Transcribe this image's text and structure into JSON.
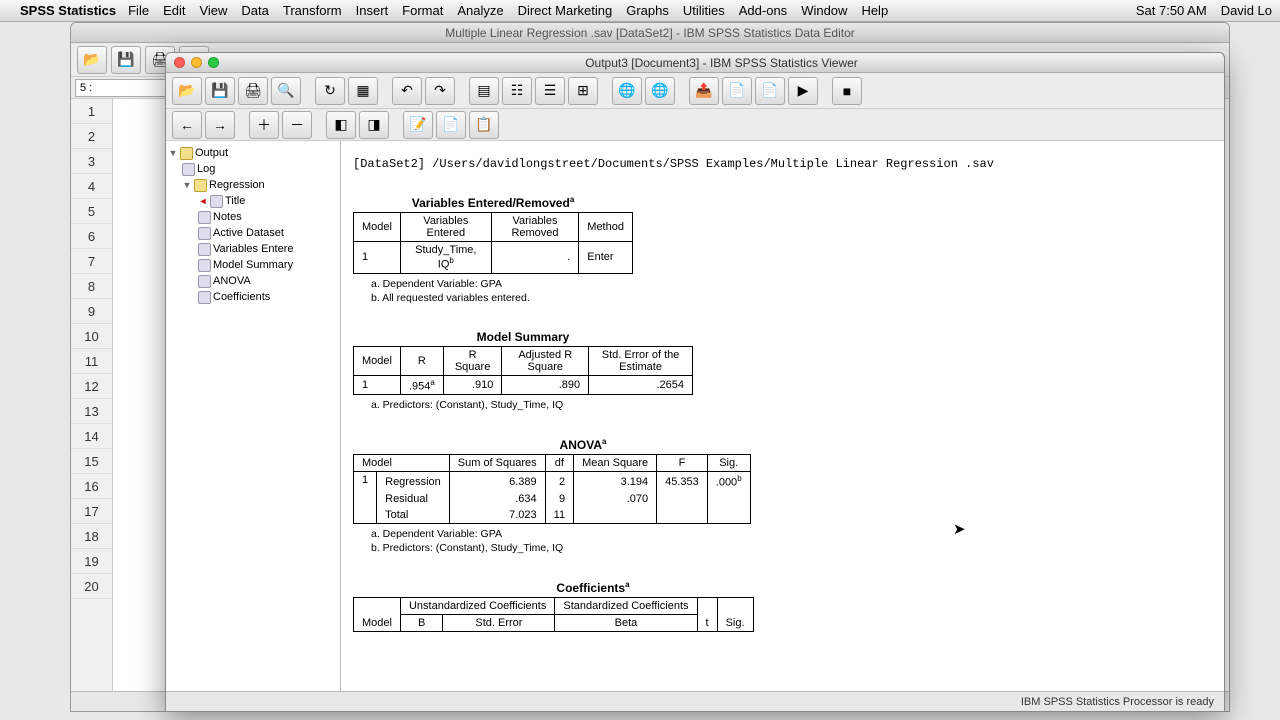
{
  "menubar": {
    "app": "SPSS Statistics",
    "items": [
      "File",
      "Edit",
      "View",
      "Data",
      "Transform",
      "Insert",
      "Format",
      "Analyze",
      "Direct Marketing",
      "Graphs",
      "Utilities",
      "Add-ons",
      "Window",
      "Help"
    ],
    "clock": "Sat 7:50 AM",
    "user": "David Lo"
  },
  "data_editor": {
    "title": "Multiple Linear Regression .sav [DataSet2] - IBM SPSS Statistics Data Editor",
    "cell_indicator": "5 :",
    "rows": [
      "1",
      "2",
      "3",
      "4",
      "5",
      "6",
      "7",
      "8",
      "9",
      "10",
      "11",
      "12",
      "13",
      "14",
      "15",
      "16",
      "17",
      "18",
      "19",
      "20"
    ],
    "status": "IBM SPSS Statistics Processor is ready"
  },
  "viewer": {
    "title": "Output3 [Document3] - IBM SPSS Statistics Viewer",
    "outline": {
      "root": "Output",
      "log": "Log",
      "regression": "Regression",
      "children": [
        "Title",
        "Notes",
        "Active Dataset",
        "Variables Entere",
        "Model Summary",
        "ANOVA",
        "Coefficients"
      ]
    },
    "dataset_line": "[DataSet2] /Users/davidlongstreet/Documents/SPSS Examples/Multiple Linear Regression .sav",
    "t1": {
      "title": "Variables Entered/Removed",
      "headers": {
        "model": "Model",
        "entered": "Variables Entered",
        "removed": "Variables Removed",
        "method": "Method"
      },
      "row": {
        "model": "1",
        "entered": "Study_Time, IQ",
        "removed": ".",
        "method": "Enter"
      },
      "fn_a": "a. Dependent Variable: GPA",
      "fn_b": "b. All requested variables entered."
    },
    "t2": {
      "title": "Model Summary",
      "headers": {
        "model": "Model",
        "r": "R",
        "r2": "R Square",
        "adjr2": "Adjusted R Square",
        "se": "Std. Error of the Estimate"
      },
      "row": {
        "model": "1",
        "r": ".954",
        "r2": ".910",
        "adjr2": ".890",
        "se": ".2654"
      },
      "fn_a": "a. Predictors: (Constant), Study_Time, IQ"
    },
    "t3": {
      "title": "ANOVA",
      "headers": {
        "model": "Model",
        "ss": "Sum of Squares",
        "df": "df",
        "ms": "Mean Square",
        "f": "F",
        "sig": "Sig."
      },
      "r1": {
        "model": "1",
        "src": "Regression",
        "ss": "6.389",
        "df": "2",
        "ms": "3.194",
        "f": "45.353",
        "sig": ".000"
      },
      "r2": {
        "src": "Residual",
        "ss": ".634",
        "df": "9",
        "ms": ".070"
      },
      "r3": {
        "src": "Total",
        "ss": "7.023",
        "df": "11"
      },
      "fn_a": "a. Dependent Variable: GPA",
      "fn_b": "b. Predictors: (Constant), Study_Time, IQ"
    },
    "t4": {
      "title": "Coefficients",
      "headers": {
        "model": "Model",
        "unstd": "Unstandardized Coefficients",
        "std": "Standardized Coefficients",
        "b": "B",
        "se": "Std. Error",
        "beta": "Beta",
        "t": "t",
        "sig": "Sig."
      }
    },
    "status": "IBM SPSS Statistics Processor is ready"
  }
}
